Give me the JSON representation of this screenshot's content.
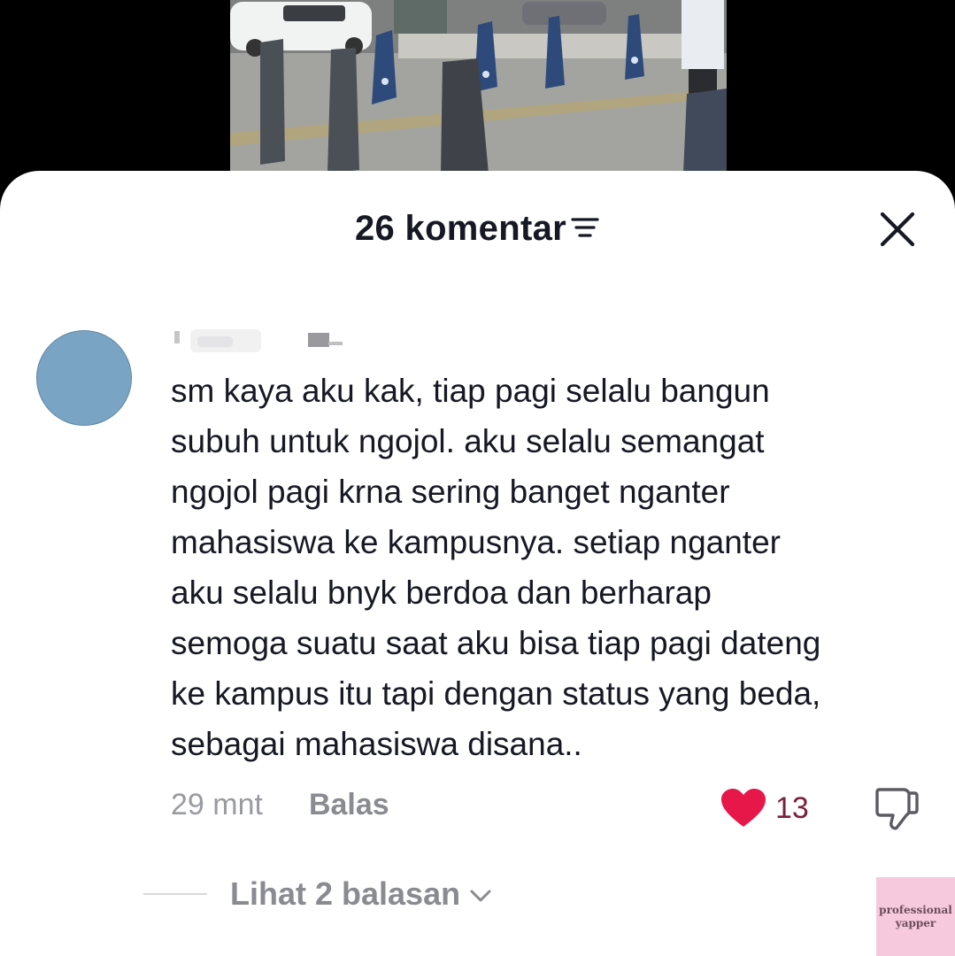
{
  "header": {
    "title": "26 komentar",
    "sort_icon": "sort-lines-icon",
    "close_icon": "close-icon"
  },
  "comment": {
    "avatar_color": "#7aa4c4",
    "text": "sm kaya aku kak, tiap pagi selalu bangun\nsubuh untuk ngojol. aku selalu semangat\nngojol pagi krna sering banget nganter\nmahasiswa ke kampusnya. setiap nganter\naku selalu bnyk berdoa dan berharap\nsemoga suatu saat aku bisa tiap pagi dateng\nke kampus itu tapi dengan status yang beda,\nsebagai mahasiswa disana..",
    "time": "29 mnt",
    "reply_label": "Balas",
    "like_count": "13",
    "like_color": "#e8174a",
    "view_replies_label": "Lihat 2 balasan"
  },
  "watermark": {
    "line1": "professional",
    "line2": "yapper"
  }
}
